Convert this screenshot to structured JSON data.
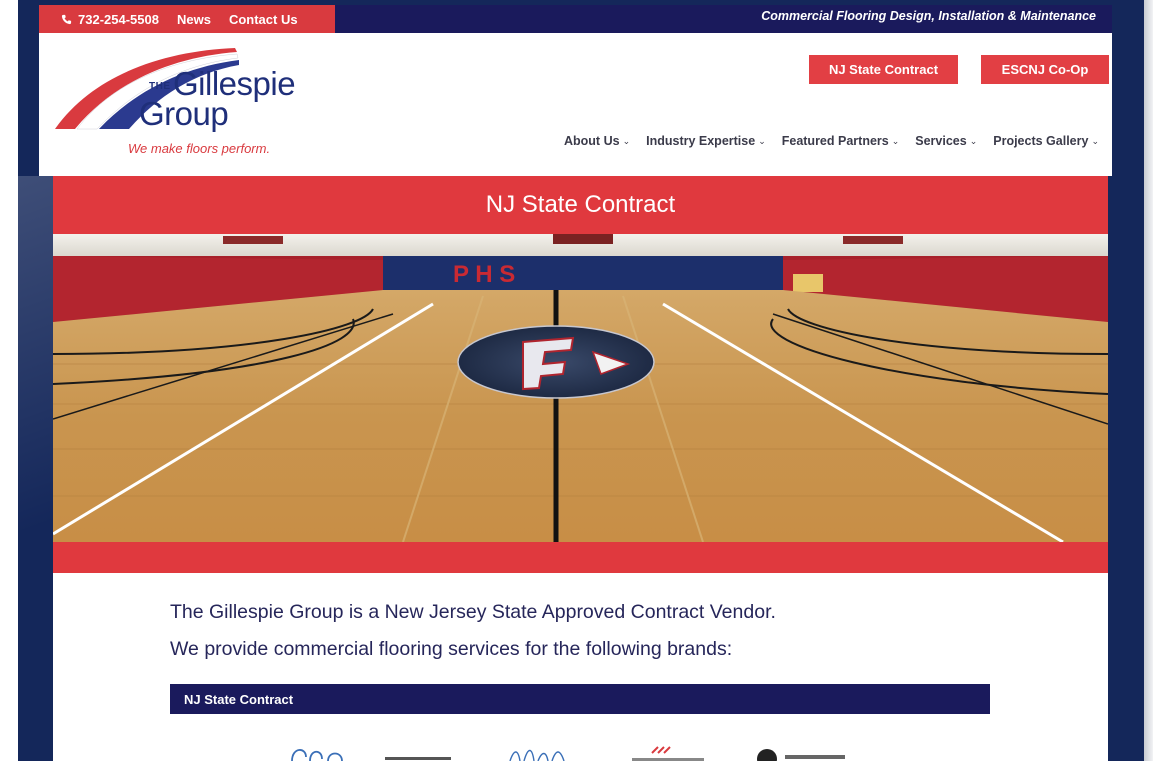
{
  "topbar": {
    "phone": "732-254-5508",
    "links": [
      "News",
      "Contact Us"
    ],
    "tagline": "Commercial Flooring Design, Installation & Maintenance"
  },
  "logo": {
    "the": "THE",
    "name_line1": "Gillespie",
    "name_line2": "Group",
    "slogan": "We make floors perform."
  },
  "header_buttons": {
    "nj": "NJ State Contract",
    "escnj": "ESCNJ Co-Op"
  },
  "nav": [
    {
      "label": "About Us"
    },
    {
      "label": "Industry Expertise"
    },
    {
      "label": "Featured Partners"
    },
    {
      "label": "Services"
    },
    {
      "label": "Projects Gallery"
    }
  ],
  "banner": {
    "title": "NJ State Contract"
  },
  "gym": {
    "wall_letters": "P H S"
  },
  "content": {
    "intro_line1": "The Gillespie Group is a New Jersey State Approved Contract Vendor.",
    "intro_line2": "We provide commercial flooring services for the following brands:",
    "table_header": "NJ State Contract"
  },
  "colors": {
    "navy": "#1a1a5c",
    "red": "#e0393e",
    "backdrop": "#14275a"
  },
  "icons": {
    "phone": "phone-icon",
    "chevron": "chevron-down-icon"
  }
}
